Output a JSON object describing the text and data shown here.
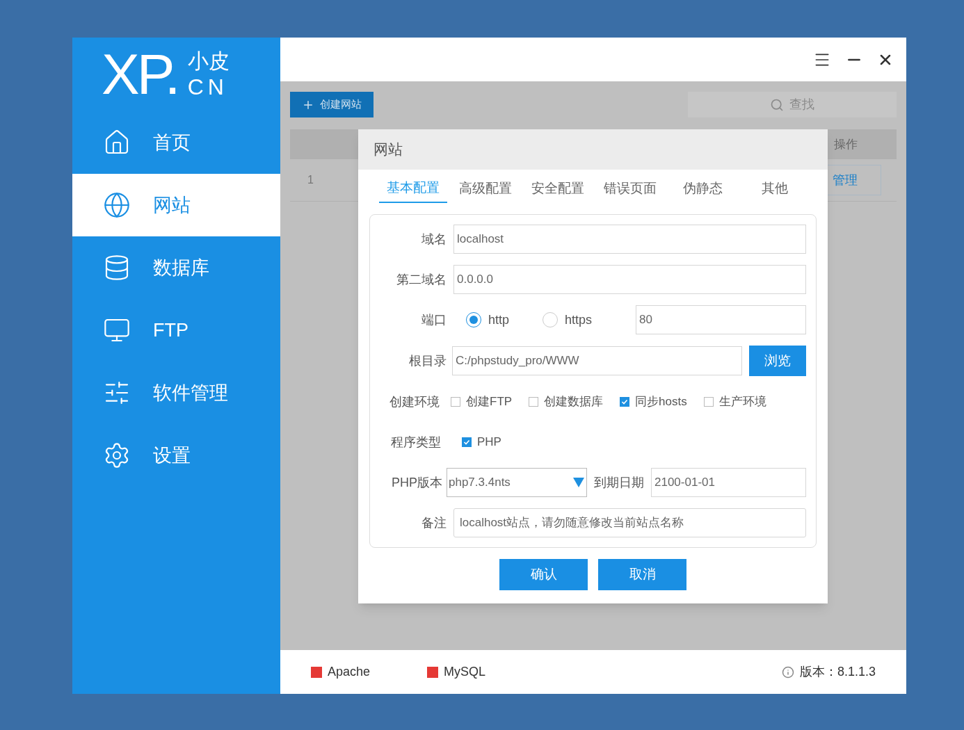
{
  "sidebar": {
    "logo": {
      "main": "XP",
      "dot": ".",
      "top": "小皮",
      "bottom": "CN"
    },
    "items": [
      {
        "label": "首页",
        "selected": false
      },
      {
        "label": "网站",
        "selected": true
      },
      {
        "label": "数据库",
        "selected": false
      },
      {
        "label": "FTP",
        "selected": false
      },
      {
        "label": "软件管理",
        "selected": false
      },
      {
        "label": "设置",
        "selected": false
      }
    ]
  },
  "toolbar": {
    "create_button": "创建网站",
    "search": {
      "placeholder": "查找"
    }
  },
  "table": {
    "columns": [
      {
        "label": "操作"
      }
    ],
    "rows": [
      {
        "index": "1",
        "action": "管理"
      }
    ]
  },
  "dialog": {
    "title": "网站",
    "tabs": [
      {
        "label": "基本配置",
        "selected": true
      },
      {
        "label": "高级配置",
        "selected": false
      },
      {
        "label": "安全配置",
        "selected": false
      },
      {
        "label": "错误页面",
        "selected": false
      },
      {
        "label": "伪静态",
        "selected": false
      },
      {
        "label": "其他",
        "selected": false
      }
    ],
    "domain": {
      "label": "域名",
      "value": "localhost"
    },
    "second_domain": {
      "label": "第二域名",
      "value": "0.0.0.0"
    },
    "port": {
      "label": "端口",
      "protocols": [
        {
          "label": "http",
          "selected": true
        },
        {
          "label": "https",
          "selected": false
        }
      ],
      "value": "80"
    },
    "root": {
      "label": "根目录",
      "value": "C:/phpstudy_pro/WWW",
      "browse": "浏览"
    },
    "environment": {
      "label": "创建环境",
      "options": [
        {
          "label": "创建FTP",
          "checked": false
        },
        {
          "label": "创建数据库",
          "checked": false
        },
        {
          "label": "同步hosts",
          "checked": true
        },
        {
          "label": "生产环境",
          "checked": false
        }
      ]
    },
    "program_type": {
      "label": "程序类型",
      "options": [
        {
          "label": "PHP",
          "checked": true
        }
      ]
    },
    "php_version": {
      "label": "PHP版本",
      "value": "php7.3.4nts"
    },
    "expiry": {
      "label": "到期日期",
      "value": "2100-01-01"
    },
    "note": {
      "label": "备注",
      "value": "localhost站点，请勿随意修改当前站点名称"
    },
    "buttons": [
      "确认",
      "取消"
    ]
  },
  "status_bar": {
    "services": [
      {
        "name": "Apache",
        "color": "#e53935"
      },
      {
        "name": "MySQL",
        "color": "#e53935"
      }
    ],
    "version": "版本：8.1.1.3"
  }
}
